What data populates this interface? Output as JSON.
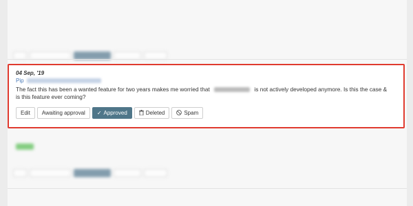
{
  "comment": {
    "date": "04 Sep, '19",
    "author": "Pip",
    "text_before": "The fact this has been a wanted feature for two years makes me worried that",
    "text_after": "is not actively developed anymore. Is this the case & is this feature ever coming?",
    "actions": {
      "edit": "Edit",
      "awaiting": "Awaiting approval",
      "approved": "Approved",
      "deleted": "Deleted",
      "spam": "Spam"
    }
  },
  "icons": {
    "approved": "check-icon",
    "deleted": "trash-icon",
    "spam": "ban-icon"
  },
  "colors": {
    "highlight_border": "#e03a2e",
    "approved_bg": "#4f7689",
    "link": "#4a7ab8"
  }
}
